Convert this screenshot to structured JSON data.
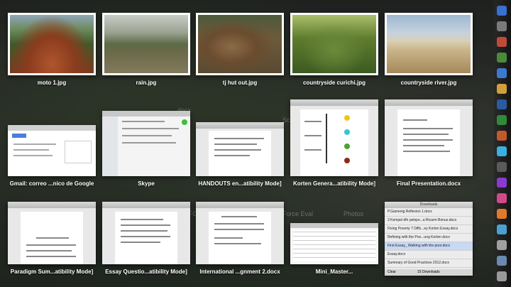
{
  "desktop": {
    "texts": [
      "Scho",
      "docx",
      "FCD",
      "Force Eval",
      "Photos"
    ]
  },
  "thumbnails": [
    {
      "label": "moto 1.jpg",
      "kind": "photo"
    },
    {
      "label": "rain.jpg",
      "kind": "photo"
    },
    {
      "label": "tj hut out.jpg",
      "kind": "photo"
    },
    {
      "label": "countryside curichi.jpg",
      "kind": "photo"
    },
    {
      "label": "countryside river.jpg",
      "kind": "photo"
    },
    {
      "label": "Gmail: correo ...nico de Google",
      "kind": "browser"
    },
    {
      "label": "Skype",
      "kind": "app"
    },
    {
      "label": "HANDOUTS en...atibility Mode]",
      "kind": "document"
    },
    {
      "label": "Korten Genera...atibility Mode]",
      "kind": "document"
    },
    {
      "label": "Final Presentation.docx",
      "kind": "document"
    },
    {
      "label": "Paradigm Sum...atibility Mode]",
      "kind": "document"
    },
    {
      "label": "Essay Questio...atibility Mode]",
      "kind": "document"
    },
    {
      "label": "International ...gnment 2.docx",
      "kind": "document"
    },
    {
      "label": "Mini_Master...",
      "kind": "spreadsheet"
    },
    {
      "label": "Downloads",
      "kind": "downloads"
    }
  ],
  "downloads": {
    "title": "Downloads",
    "items": [
      "P.Gamenig Reflexion 1.docx",
      "3 Kempel dfn pelops...a Ricarm Bonus.docx",
      "Fixing Poverty 7 Diffs...ey Korten Essay.docx",
      "Refining with the Poo...ung Korten docx",
      "First Essay_ Walking with the poor.docx",
      "Essay.docx",
      "Summary of Good Practices 2012.docx"
    ],
    "footer_clear": "Clear",
    "footer_count": "15 Downloads"
  }
}
